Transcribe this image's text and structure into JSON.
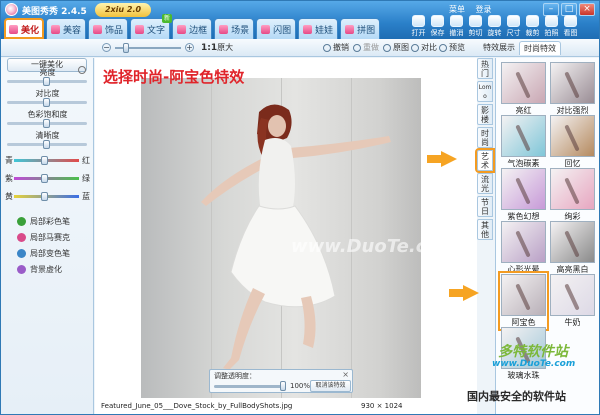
{
  "window": {
    "title": "美图秀秀 2.4.5",
    "brand_badge": "2xiu 2.0",
    "top_links": [
      "菜单",
      "登录"
    ],
    "controls": [
      "–",
      "□",
      "×"
    ]
  },
  "main_tabs": [
    {
      "label": "美化",
      "active": true
    },
    {
      "label": "美容"
    },
    {
      "label": "饰品"
    },
    {
      "label": "文字",
      "badge": "新"
    },
    {
      "label": "边框"
    },
    {
      "label": "场景"
    },
    {
      "label": "闪图"
    },
    {
      "label": "娃娃"
    },
    {
      "label": "拼图"
    }
  ],
  "tools": [
    "打开",
    "保存",
    "撤消",
    "剪切",
    "旋转",
    "尺寸",
    "裁剪",
    "拍照",
    "看图"
  ],
  "toolbar2": {
    "zoom_actual": "1:1",
    "zoom_actual_suffix": "原大",
    "undo": "撤销",
    "redo": "重做",
    "original": "原图",
    "compare": "对比",
    "preview": "预览"
  },
  "effect_tabs": [
    "特效展示",
    "时尚特效"
  ],
  "left_panel": {
    "one_click": "一键美化",
    "sliders": [
      {
        "label": "亮度",
        "value": 0.5
      },
      {
        "label": "对比度",
        "value": 0.5
      },
      {
        "label": "色彩饱和度",
        "value": 0.5
      },
      {
        "label": "清晰度",
        "value": 0.5
      }
    ],
    "color_sliders": [
      {
        "left": "青",
        "right": "红",
        "value": 0.5
      },
      {
        "left": "紫",
        "right": "绿",
        "value": 0.5
      },
      {
        "left": "黄",
        "right": "蓝",
        "value": 0.5
      }
    ],
    "features": [
      {
        "label": "局部彩色笔",
        "color": "#3aa03a"
      },
      {
        "label": "局部马赛克",
        "color": "#d94b8a"
      },
      {
        "label": "局部变色笔",
        "color": "#3b86c7"
      },
      {
        "label": "背景虚化",
        "color": "#9a5cc8"
      }
    ]
  },
  "canvas": {
    "caption": "选择时尚-阿宝色特效",
    "watermark": "www.DuoTe.com",
    "opacity_panel": {
      "label": "调整透明度：",
      "value": "100%",
      "value_fraction": 1.0,
      "cancel": "取消该特效",
      "close": "×"
    },
    "file_name": "Featured_June_05___Dove_Stock_by_FullBodyShots.jpg",
    "dimensions": "930 × 1024"
  },
  "categories": [
    "热门",
    "Lomo",
    "影楼",
    "时尚",
    "艺术",
    "流光",
    "节日",
    "其他"
  ],
  "active_category": "艺术",
  "thumbnails": [
    {
      "label": "亮红",
      "tint": "#c9a7b3"
    },
    {
      "label": "对比强烈",
      "tint": "#9a8d95"
    },
    {
      "label": "气泡碳素",
      "tint": "#7fc6d8"
    },
    {
      "label": "回忆",
      "tint": "#b58a5f"
    },
    {
      "label": "紫色幻想",
      "tint": "#c79ad8"
    },
    {
      "label": "绚彩",
      "tint": "#e7a6c0"
    },
    {
      "label": "心形光晕",
      "tint": "#b9a0c6"
    },
    {
      "label": "高亮黑白",
      "tint": "#8a8a8a"
    },
    {
      "label": "阿宝色",
      "tint": "#b9b0b8",
      "selected": true
    },
    {
      "label": "牛奶",
      "tint": "#ddd9e6"
    },
    {
      "label": "玻璃水珠",
      "tint": "#a3c8d8"
    }
  ],
  "site_logo": {
    "line1": "多特软件站",
    "line2": "www.DuoTe.com"
  },
  "bottom_slogan": "国内最安全的软件站",
  "accent": "#f39b21"
}
